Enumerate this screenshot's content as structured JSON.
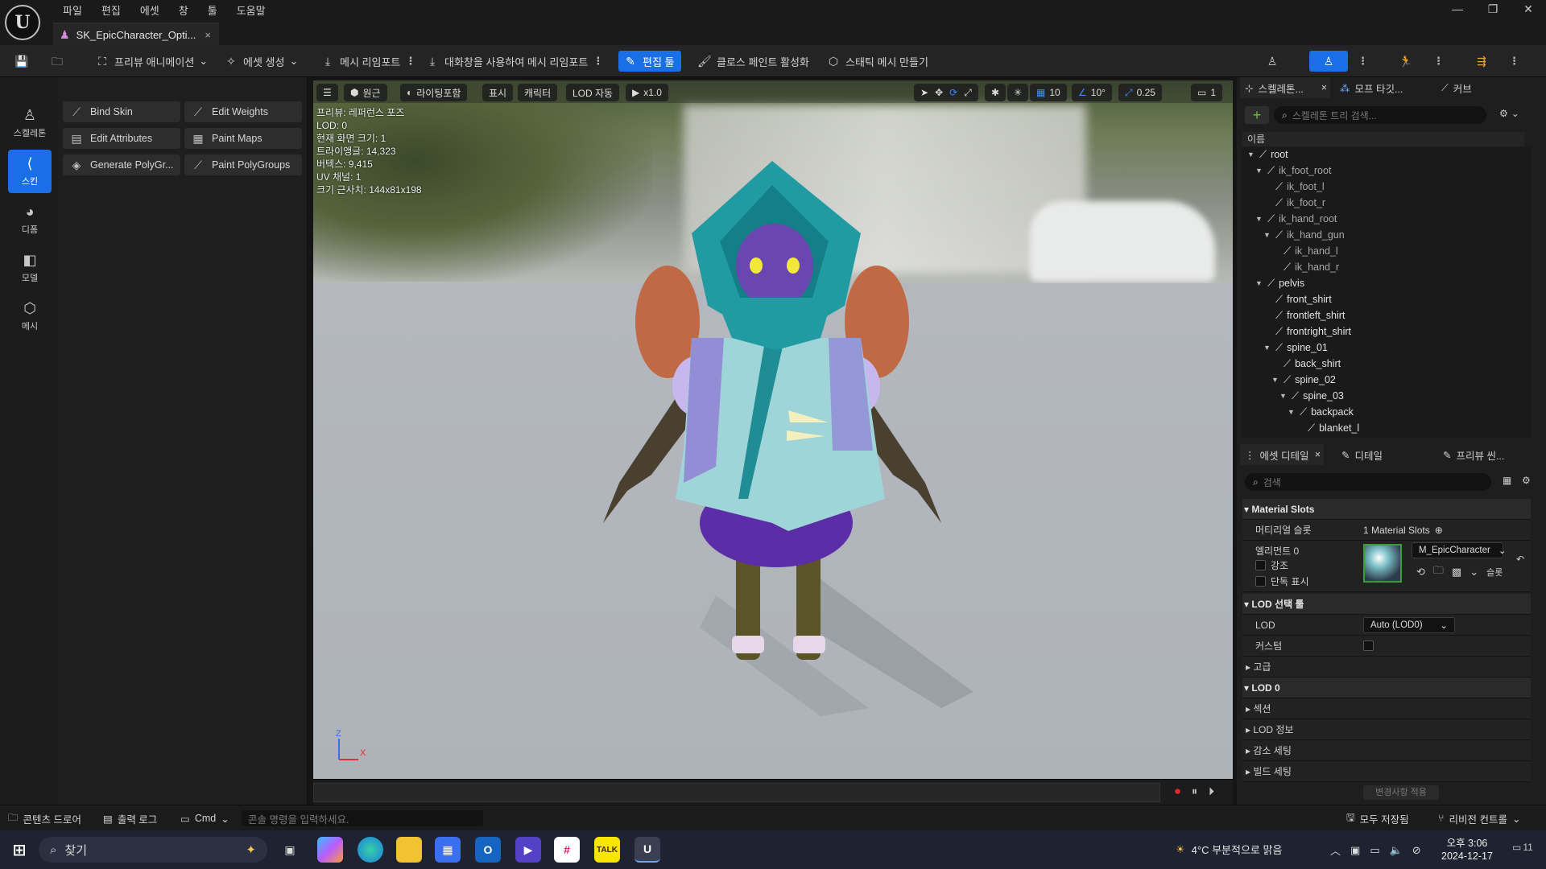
{
  "menu": [
    "파일",
    "편집",
    "에셋",
    "창",
    "툴",
    "도움말"
  ],
  "document_tab": {
    "title": "SK_EpicCharacter_Opti...",
    "close": "×"
  },
  "window_controls": {
    "minimize": "—",
    "restore": "❐",
    "close": "✕"
  },
  "toolbar": {
    "preview_anim": "프리뷰 애니메이션",
    "create_asset": "에셋 생성",
    "mesh_reimport": "메시 리임포트",
    "reimport_dialog": "대화창을 사용하여 메시 리임포트",
    "edit_tools": "편집 툴",
    "cloth_paint": "클로스 페인트 활성화",
    "make_static": "스태틱 메시 만들기"
  },
  "modes": [
    "스켈레톤",
    "스킨",
    "디폼",
    "모델",
    "메시"
  ],
  "tools": [
    "Bind Skin",
    "Edit Weights",
    "Edit Attributes",
    "Paint Maps",
    "Generate PolyGr...",
    "Paint PolyGroups"
  ],
  "viewport": {
    "perspective": "원근",
    "lighting": "라이팅포함",
    "show": "표시",
    "character": "캐릭터",
    "lod": "LOD 자동",
    "speed": "x1.0",
    "grid": "10",
    "angle": "10°",
    "scale": "0.25",
    "camera": "1",
    "stats": [
      "프리뷰: 레퍼런스 포즈",
      "LOD: 0",
      "현재 화면 크기: 1",
      "트라이앵글: 14,323",
      "버텍스: 9,415",
      "UV 채널: 1",
      "크기 근사치: 144x81x198"
    ],
    "axis_z": "Z",
    "axis_x": "X"
  },
  "skeleton_panel": {
    "tabs": [
      "스켈레톤...",
      "모프 타깃...",
      "커브"
    ],
    "search_placeholder": "스켈레톤 트리 검색...",
    "column": "이름",
    "bones": [
      {
        "name": "root",
        "depth": 0,
        "open": true,
        "dim": false
      },
      {
        "name": "ik_foot_root",
        "depth": 1,
        "open": true,
        "dim": true
      },
      {
        "name": "ik_foot_l",
        "depth": 2,
        "open": false,
        "dim": true
      },
      {
        "name": "ik_foot_r",
        "depth": 2,
        "open": false,
        "dim": true
      },
      {
        "name": "ik_hand_root",
        "depth": 1,
        "open": true,
        "dim": true
      },
      {
        "name": "ik_hand_gun",
        "depth": 2,
        "open": true,
        "dim": true
      },
      {
        "name": "ik_hand_l",
        "depth": 3,
        "open": false,
        "dim": true
      },
      {
        "name": "ik_hand_r",
        "depth": 3,
        "open": false,
        "dim": true
      },
      {
        "name": "pelvis",
        "depth": 1,
        "open": true,
        "dim": false
      },
      {
        "name": "front_shirt",
        "depth": 2,
        "open": false,
        "dim": false
      },
      {
        "name": "frontleft_shirt",
        "depth": 2,
        "open": false,
        "dim": false
      },
      {
        "name": "frontright_shirt",
        "depth": 2,
        "open": false,
        "dim": false
      },
      {
        "name": "spine_01",
        "depth": 2,
        "open": true,
        "dim": false
      },
      {
        "name": "back_shirt",
        "depth": 3,
        "open": false,
        "dim": false
      },
      {
        "name": "spine_02",
        "depth": 3,
        "open": true,
        "dim": false
      },
      {
        "name": "spine_03",
        "depth": 4,
        "open": true,
        "dim": false
      },
      {
        "name": "backpack",
        "depth": 5,
        "open": true,
        "dim": false
      },
      {
        "name": "blanket_l",
        "depth": 6,
        "open": false,
        "dim": false
      }
    ]
  },
  "details_panel": {
    "tabs": [
      "에셋 디테일",
      "디테일",
      "프리뷰 씬..."
    ],
    "search_placeholder": "검색",
    "material_slots_header": "Material Slots",
    "material_slots_label": "머티리얼 슬롯",
    "material_slots_value": "1 Material Slots",
    "element_label": "엘리먼트 0",
    "highlight": "강조",
    "isolate": "단독 표시",
    "material_name": "M_EpicCharacter",
    "slot_suffix": "슬롯",
    "lod_picker_header": "LOD 선택 툴",
    "lod_label": "LOD",
    "lod_value": "Auto (LOD0)",
    "custom_label": "커스텀",
    "advanced": "고급",
    "lod0_header": "LOD 0",
    "sections": "섹션",
    "lod_info": "LOD 정보",
    "reduction": "감소 세팅",
    "build": "빌드 세팅",
    "apply": "변경사항 적용"
  },
  "statusbar": {
    "content_drawer": "콘텐츠 드로어",
    "output_log": "출력 로그",
    "cmd": "Cmd",
    "console_placeholder": "콘솔 명령을 입력하세요.",
    "save_all": "모두 저장됨",
    "revision": "리비전 컨트롤"
  },
  "taskbar": {
    "search": "찾기",
    "weather": "4°C 부분적으로 맑음",
    "time": "오후 3:06",
    "date": "2024-12-17",
    "notif": "11"
  }
}
